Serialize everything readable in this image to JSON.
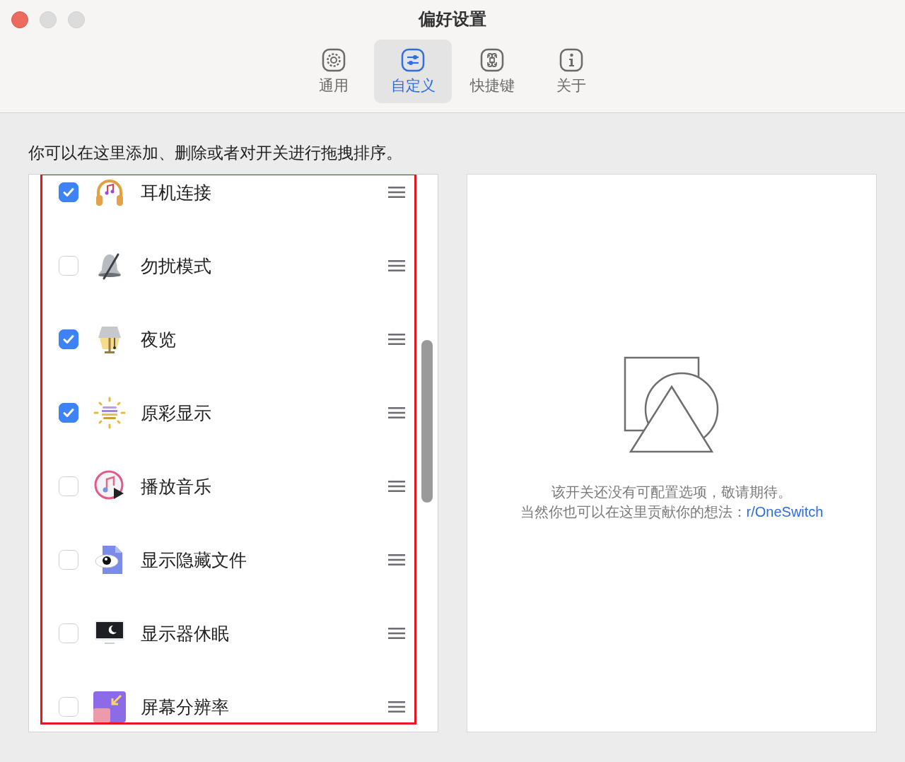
{
  "window": {
    "title": "偏好设置"
  },
  "tabs": [
    {
      "label": "通用",
      "selected": false
    },
    {
      "label": "自定义",
      "selected": true
    },
    {
      "label": "快捷键",
      "selected": false
    },
    {
      "label": "关于",
      "selected": false
    }
  ],
  "description": "你可以在这里添加、删除或者对开关进行拖拽排序。",
  "switches": [
    {
      "label": "耳机连接",
      "checked": true
    },
    {
      "label": "勿扰模式",
      "checked": false
    },
    {
      "label": "夜览",
      "checked": true
    },
    {
      "label": "原彩显示",
      "checked": true
    },
    {
      "label": "播放音乐",
      "checked": false
    },
    {
      "label": "显示隐藏文件",
      "checked": false
    },
    {
      "label": "显示器休眠",
      "checked": false
    },
    {
      "label": "屏幕分辨率",
      "checked": false
    }
  ],
  "detail": {
    "message": "该开关还没有可配置选项，敬请期待。",
    "prompt": "当然你也可以在这里贡献你的想法：",
    "link": "r/OneSwitch"
  }
}
